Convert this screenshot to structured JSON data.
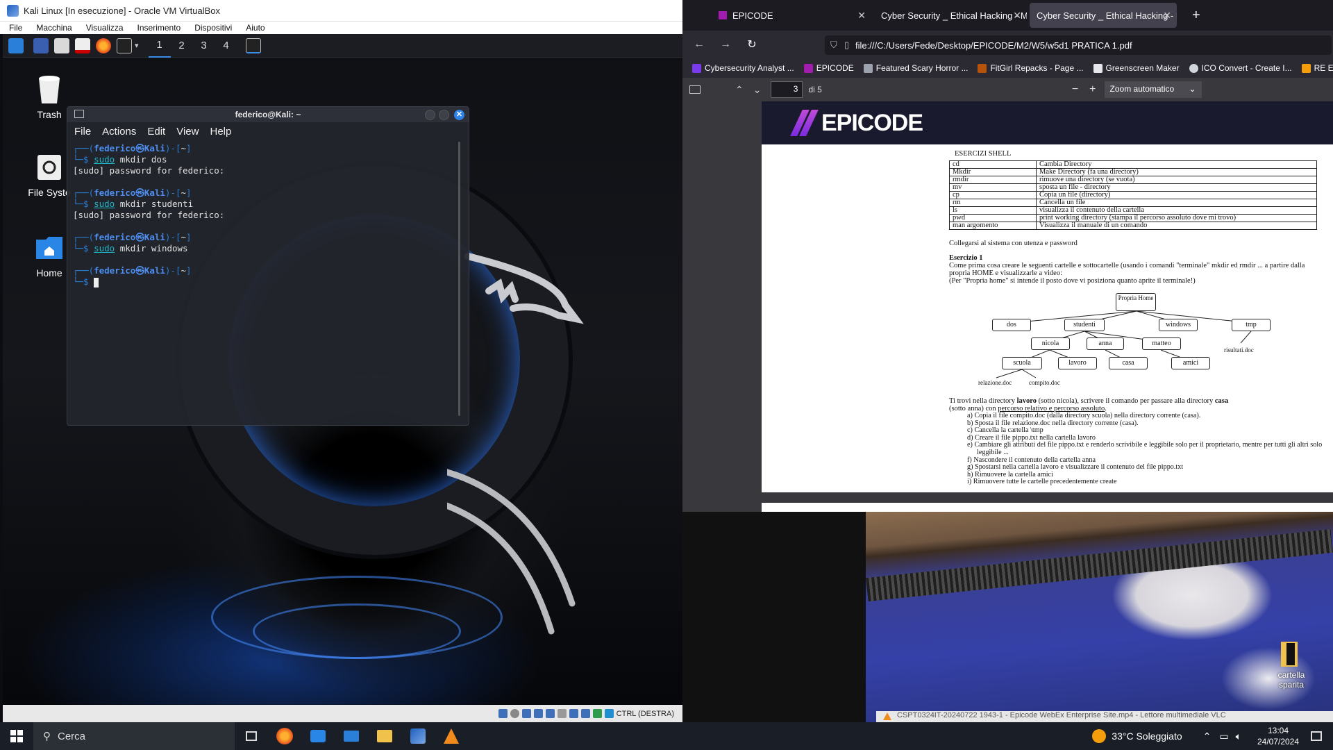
{
  "vbox": {
    "title": "Kali Linux [In esecuzione] - Oracle VM VirtualBox",
    "menu": [
      "File",
      "Macchina",
      "Visualizza",
      "Inserimento",
      "Dispositivi",
      "Aiuto"
    ],
    "status_text": "CTRL (DESTRA)"
  },
  "kali_panel": {
    "workspaces": [
      "1",
      "2",
      "3",
      "4"
    ]
  },
  "desktop_icons": {
    "trash": "Trash",
    "filesystem": "File Syste",
    "home": "Home"
  },
  "terminal": {
    "title": "federico@Kali: ~",
    "menu": [
      "File",
      "Actions",
      "Edit",
      "View",
      "Help"
    ],
    "prompt_user": "federico㉿Kali",
    "prompt_dir": "~",
    "commands": [
      {
        "sudo": "sudo",
        "cmd": " mkdir dos",
        "output": "[sudo] password for federico:"
      },
      {
        "sudo": "sudo",
        "cmd": " mkdir studenti",
        "output": "[sudo] password for federico:"
      },
      {
        "sudo": "sudo",
        "cmd": " mkdir windows",
        "output": ""
      }
    ]
  },
  "firefox": {
    "tabs": [
      {
        "label": "EPICODE",
        "active": false
      },
      {
        "label": "Cyber Security _ Ethical Hacking - M",
        "active": false
      },
      {
        "label": "Cyber Security _ Ethical Hacking - M",
        "active": true
      }
    ],
    "url": "file:///C:/Users/Fede/Desktop/EPICODE/M2/W5/w5d1 PRATICA 1.pdf",
    "bookmarks": [
      {
        "label": "Cybersecurity Analyst ...",
        "color": "#7c3aed"
      },
      {
        "label": "EPICODE",
        "color": "#a21caf"
      },
      {
        "label": "Featured Scary Horror ...",
        "color": "#9ca3af"
      },
      {
        "label": "FitGirl Repacks - Page ...",
        "color": "#b45309"
      },
      {
        "label": "Greenscreen Maker",
        "color": "#e5e7eb"
      },
      {
        "label": "ICO Convert - Create I...",
        "color": "#d1d5db"
      },
      {
        "label": "RE Engine",
        "color": "#f59e0b"
      }
    ],
    "pdf": {
      "page": "3",
      "of": "di 5",
      "zoom": "Zoom automatico"
    }
  },
  "pdf_doc": {
    "logo": "EPICODE",
    "heading": "ESERCIZI SHELL",
    "commands_table": [
      [
        "cd",
        "Cambia Directory"
      ],
      [
        "Mkdir",
        "Make Directory (fa una directory)"
      ],
      [
        "rmdir",
        "rimuove una directory (se vuota)"
      ],
      [
        "mv",
        "sposta un file - directory"
      ],
      [
        "cp",
        "Copia un file (directory)"
      ],
      [
        "rm",
        "Cancella un file"
      ],
      [
        "ls",
        "visualizza il contenuto della cartella"
      ],
      [
        "pwd",
        "print working directory (stampa il percorso assoluto dove mi trovo)"
      ],
      [
        "man argomento",
        "Visualizza il manuale di un comando"
      ]
    ],
    "login_line": "Collegarsi al sistema con utenza e password",
    "ex_title": "Esercizio 1",
    "ex_text": "Come prima cosa creare le seguenti cartelle e sottocartelle (usando i comandi \"terminale\" mkdir ed rmdir ... a partire dalla propria HOME e visualizzarle a video:",
    "ex_note": "(Per \"Propria home\" si intende il posto dove vi posiziona quanto aprite il terminale!)",
    "tree": {
      "root": "Propria Home",
      "level1": [
        "dos",
        "studenti",
        "windows",
        "tmp"
      ],
      "level2": [
        "nicola",
        "anna",
        "matteo"
      ],
      "level3": [
        "scuola",
        "lavoro",
        "casa",
        "amici"
      ],
      "files": [
        "risultati.doc",
        "relazione.doc",
        "compito.doc"
      ]
    },
    "task_intro_a": "Ti trovi nella directory ",
    "task_intro_b": "lavoro",
    "task_intro_c": " (sotto nicola), scrivere il comando per passare alla directory ",
    "task_intro_d": "casa",
    "task_intro_e": "(sotto anna) con ",
    "task_intro_f": "percorso relativo e percorso assoluto",
    "task_intro_g": ".",
    "tasks": [
      "a)   Copia il file compito.doc (dalla directory scuola) nella directory corrente (casa).",
      "b)   Sposta il file relazione.doc nella directory corrente (casa).",
      "c)   Cancella la cartella \\tmp",
      "d)   Creare il file pippo.txt nella cartella lavoro",
      "e)   Cambiare gli attributi del file pippo.txt e renderlo scrivibile e leggibile solo per il proprietario, mentre per tutti gli altri solo leggibile ...",
      "f)    Nascondere il contenuto della cartella anna",
      "g)   Spostarsi nella cartella lavoro e visualizzare il contenuto del file pippo.txt",
      "h)   Rimuovere la cartella amici",
      "i)    Rimuovere tutte le cartelle precedentemente create"
    ]
  },
  "desktop": {
    "folder_label": "cartella sparita",
    "vlc_title": "CSPT0324IT-20240722 1943-1 - Epicode WebEx Enterprise Site.mp4 - Lettore multimediale VLC"
  },
  "taskbar": {
    "search_placeholder": "Cerca",
    "weather": "33°C  Soleggiato",
    "time": "13:04",
    "date": "24/07/2024"
  }
}
